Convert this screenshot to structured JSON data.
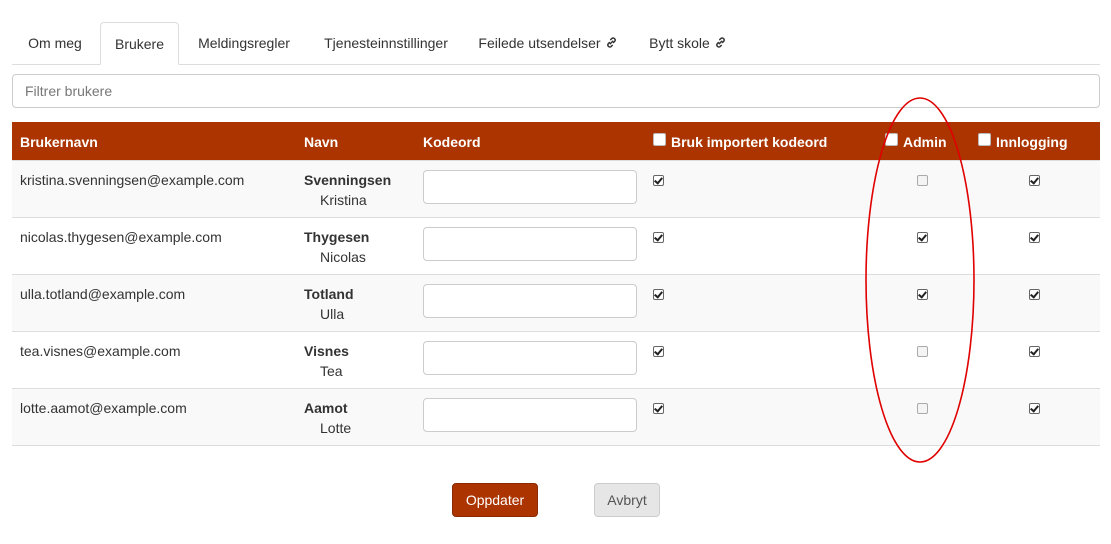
{
  "tabs": [
    {
      "label": "Om meg",
      "active": false,
      "external": false
    },
    {
      "label": "Brukere",
      "active": true,
      "external": false
    },
    {
      "label": "Meldingsregler",
      "active": false,
      "external": false
    },
    {
      "label": "Tjenesteinnstillinger",
      "active": false,
      "external": false
    },
    {
      "label": "Feilede utsendelser",
      "active": false,
      "external": true
    },
    {
      "label": "Bytt skole",
      "active": false,
      "external": true
    }
  ],
  "filter": {
    "placeholder": "Filtrer brukere",
    "value": ""
  },
  "table": {
    "headers": {
      "username": "Brukernavn",
      "name": "Navn",
      "password": "Kodeord",
      "imported": "Bruk importert kodeord",
      "admin": "Admin",
      "login": "Innlogging"
    },
    "rows": [
      {
        "username": "kristina.svenningsen@example.com",
        "last_name": "Svenningsen",
        "first_name": "Kristina",
        "password": "",
        "imported": true,
        "admin": false,
        "login": true
      },
      {
        "username": "nicolas.thygesen@example.com",
        "last_name": "Thygesen",
        "first_name": "Nicolas",
        "password": "",
        "imported": true,
        "admin": true,
        "login": true
      },
      {
        "username": "ulla.totland@example.com",
        "last_name": "Totland",
        "first_name": "Ulla",
        "password": "",
        "imported": true,
        "admin": true,
        "login": true
      },
      {
        "username": "tea.visnes@example.com",
        "last_name": "Visnes",
        "first_name": "Tea",
        "password": "",
        "imported": true,
        "admin": false,
        "login": true
      },
      {
        "username": "lotte.aamot@example.com",
        "last_name": "Aamot",
        "first_name": "Lotte",
        "password": "",
        "imported": true,
        "admin": false,
        "login": true
      }
    ]
  },
  "buttons": {
    "update": "Oppdater",
    "cancel": "Avbryt"
  },
  "colors": {
    "accent": "#ab3400",
    "annotation": "#e00000"
  },
  "icons": {
    "external_tab": "link-icon"
  }
}
